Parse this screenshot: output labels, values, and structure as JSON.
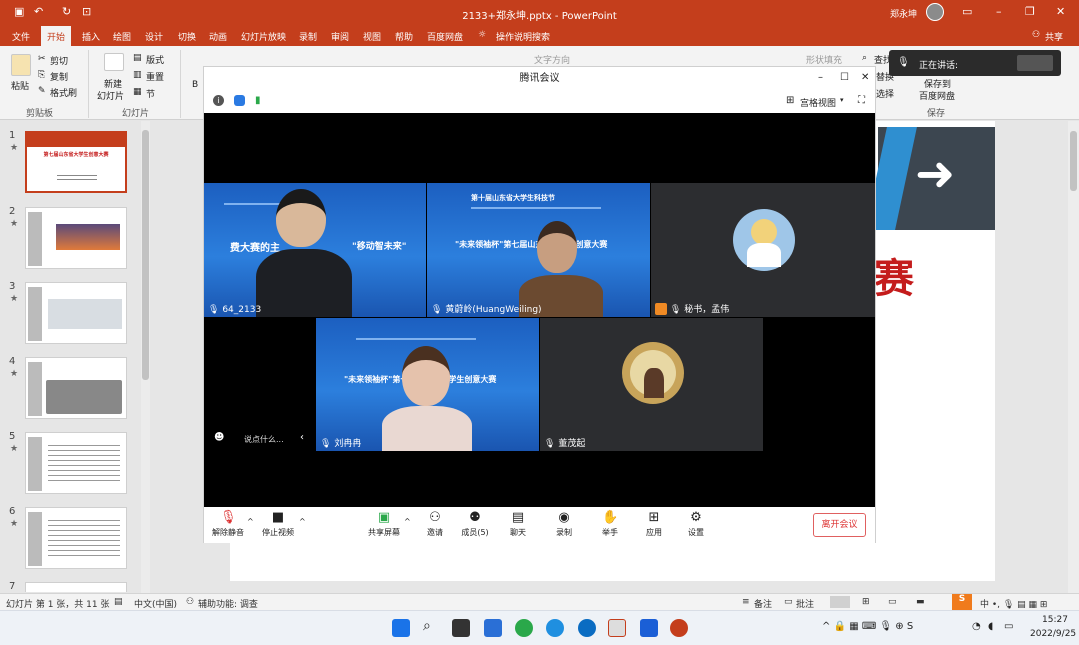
{
  "ppt": {
    "title": "2133+郑永坤.pptx  -  PowerPoint",
    "user": "郑永坤",
    "share_label": "共享",
    "menu": [
      "文件",
      "开始",
      "插入",
      "绘图",
      "设计",
      "切换",
      "动画",
      "幻灯片放映",
      "录制",
      "审阅",
      "视图",
      "帮助",
      "百度网盘"
    ],
    "search_label": "操作说明搜索",
    "ribbon": {
      "paste": "粘贴",
      "cut": "剪切",
      "copy": "复制",
      "format_painter": "格式刷",
      "clipboard_group": "剪贴板",
      "new_slide_1": "新建",
      "new_slide_2": "幻灯片",
      "layout": "版式",
      "reset": "重置",
      "section": "节",
      "slides_group": "幻灯片",
      "find": "查找",
      "replace": "替换",
      "select": "选择",
      "save_to_1": "保存到",
      "save_to_2": "百度网盘",
      "save_group": "保存",
      "shape_fill": "形状填充",
      "text_direction": "文字方向"
    },
    "thumbnails": [
      {
        "num": "1",
        "star": "★",
        "title": "第七届山东省大学生创意大赛"
      },
      {
        "num": "2",
        "star": "★"
      },
      {
        "num": "3",
        "star": "★"
      },
      {
        "num": "4",
        "star": "★"
      },
      {
        "num": "5",
        "star": "★"
      },
      {
        "num": "6",
        "star": "★"
      },
      {
        "num": "7",
        "star": ""
      }
    ],
    "slide_text": "赛",
    "status": {
      "slide_info": "幻灯片 第 1 张，共 11 张",
      "language": "中文(中国)",
      "accessibility": "辅助功能: 调查",
      "notes": "备注",
      "comments": "批注"
    }
  },
  "meeting": {
    "title": "腾讯会议",
    "view_label": "宫格视图",
    "speaking_label": "正在讲话:",
    "banner_1": "\"未来领袖杯\"第七届山东省大学生创意大赛",
    "banner_2": "\"未来领袖杯\"第七届山东省大学生创意大赛",
    "banner_left": "费大赛的主",
    "banner_left_2": "\"移动智未来\"",
    "banner_top": "第十届山东省大学生科技节",
    "participants": [
      {
        "name": "64_2133"
      },
      {
        "name": "黄蔚岭(HuangWeiling)"
      },
      {
        "name": "秘书，孟伟"
      },
      {
        "name": "刘冉冉"
      },
      {
        "name": "董茂起"
      }
    ],
    "chat_placeholder": "说点什么...",
    "controls": {
      "unmute": "解除静音",
      "stop_video": "停止视频",
      "share_screen": "共享屏幕",
      "invite": "邀请",
      "members": "成员(5)",
      "chat": "聊天",
      "record": "录制",
      "raise_hand": "举手",
      "apps": "应用",
      "settings": "设置",
      "leave": "离开会议"
    },
    "colors": {
      "leave": "#dd3333",
      "ppt_red": "#c43e1c",
      "tile_blue": "#2c7fdd"
    }
  },
  "taskbar": {
    "time": "15:27",
    "date": "2022/9/25"
  }
}
